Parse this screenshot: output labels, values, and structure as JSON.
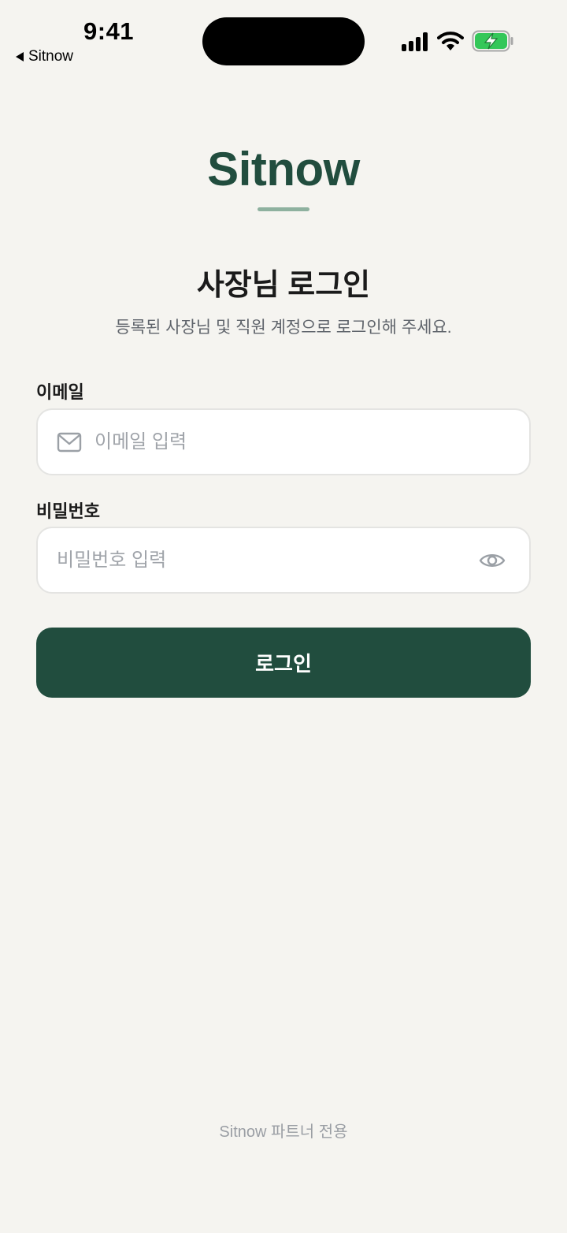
{
  "status_bar": {
    "time": "9:41",
    "back_label": "Sitnow",
    "battery_color": "#34c759"
  },
  "brand": {
    "logo": "Sitnow",
    "primary_color": "#214d3e",
    "accent_color": "#8eb19f"
  },
  "header": {
    "title": "사장님 로그인",
    "subtitle": "등록된 사장님 및 직원 계정으로 로그인해 주세요."
  },
  "form": {
    "email": {
      "label": "이메일",
      "placeholder": "이메일 입력",
      "value": "",
      "icon": "mail-icon"
    },
    "password": {
      "label": "비밀번호",
      "placeholder": "비밀번호 입력",
      "value": "",
      "icon": "eye-icon"
    },
    "submit_label": "로그인"
  },
  "footer": {
    "text": "Sitnow 파트너 전용"
  }
}
